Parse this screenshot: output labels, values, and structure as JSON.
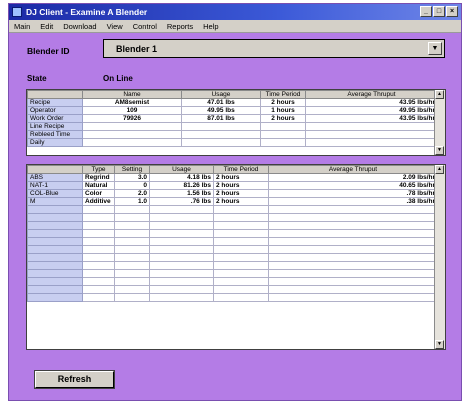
{
  "window": {
    "title": "DJ Client - Examine A Blender",
    "controls": {
      "minimize": "_",
      "maximize": "□",
      "close": "×"
    }
  },
  "menu": [
    "Main",
    "Edit",
    "Download",
    "View",
    "Control",
    "Reports",
    "Help"
  ],
  "blender": {
    "label": "Blender ID",
    "selected": "Blender  1",
    "dropdown_icon": "chevron-down-icon"
  },
  "state": {
    "label": "State",
    "value": "On Line"
  },
  "top_table": {
    "columns": [
      "",
      "Name",
      "Usage",
      "Time Period",
      "Average Thruput"
    ],
    "rows": [
      {
        "label": "Recipe",
        "name": "AM8semist",
        "usage": "47.01 lbs",
        "period": "2 hours",
        "thruput": "43.95 lbs/hr"
      },
      {
        "label": "Operator",
        "name": "109",
        "usage": "49.95 lbs",
        "period": "1 hours",
        "thruput": "49.95 lbs/hr"
      },
      {
        "label": "Work Order",
        "name": "79926",
        "usage": "87.01 lbs",
        "period": "2 hours",
        "thruput": "43.95 lbs/hr"
      },
      {
        "label": "Line Recipe",
        "name": "",
        "usage": "",
        "period": "",
        "thruput": ""
      },
      {
        "label": "Rebleed Time",
        "name": "",
        "usage": "",
        "period": "",
        "thruput": ""
      },
      {
        "label": "Daily",
        "name": "",
        "usage": "",
        "period": "",
        "thruput": ""
      }
    ]
  },
  "bottom_table": {
    "columns": [
      "",
      "Type",
      "Setting",
      "Usage",
      "Time Period",
      "Average Thruput"
    ],
    "rows": [
      {
        "name": "ABS",
        "type": "Regrind",
        "setting": "3.0",
        "usage": "4.18 lbs",
        "period": "2 hours",
        "thruput": "2.09 lbs/hr"
      },
      {
        "name": "NAT-1",
        "type": "Natural",
        "setting": "0",
        "usage": "81.26 lbs",
        "period": "2 hours",
        "thruput": "40.65 lbs/hr"
      },
      {
        "name": "COL-Blue",
        "type": "Color",
        "setting": "2.0",
        "usage": "1.56 lbs",
        "period": "2 hours",
        "thruput": ".78 lbs/hr"
      },
      {
        "name": "M",
        "type": "Additive",
        "setting": "1.0",
        "usage": ".76 lbs",
        "period": "2 hours",
        "thruput": ".38 lbs/hr"
      }
    ],
    "empty_rows": 12
  },
  "refresh_label": "Refresh",
  "colors": {
    "background": "#b47ce6",
    "title_bar": "#1b2aa6",
    "row_header": "#c8cef0"
  }
}
